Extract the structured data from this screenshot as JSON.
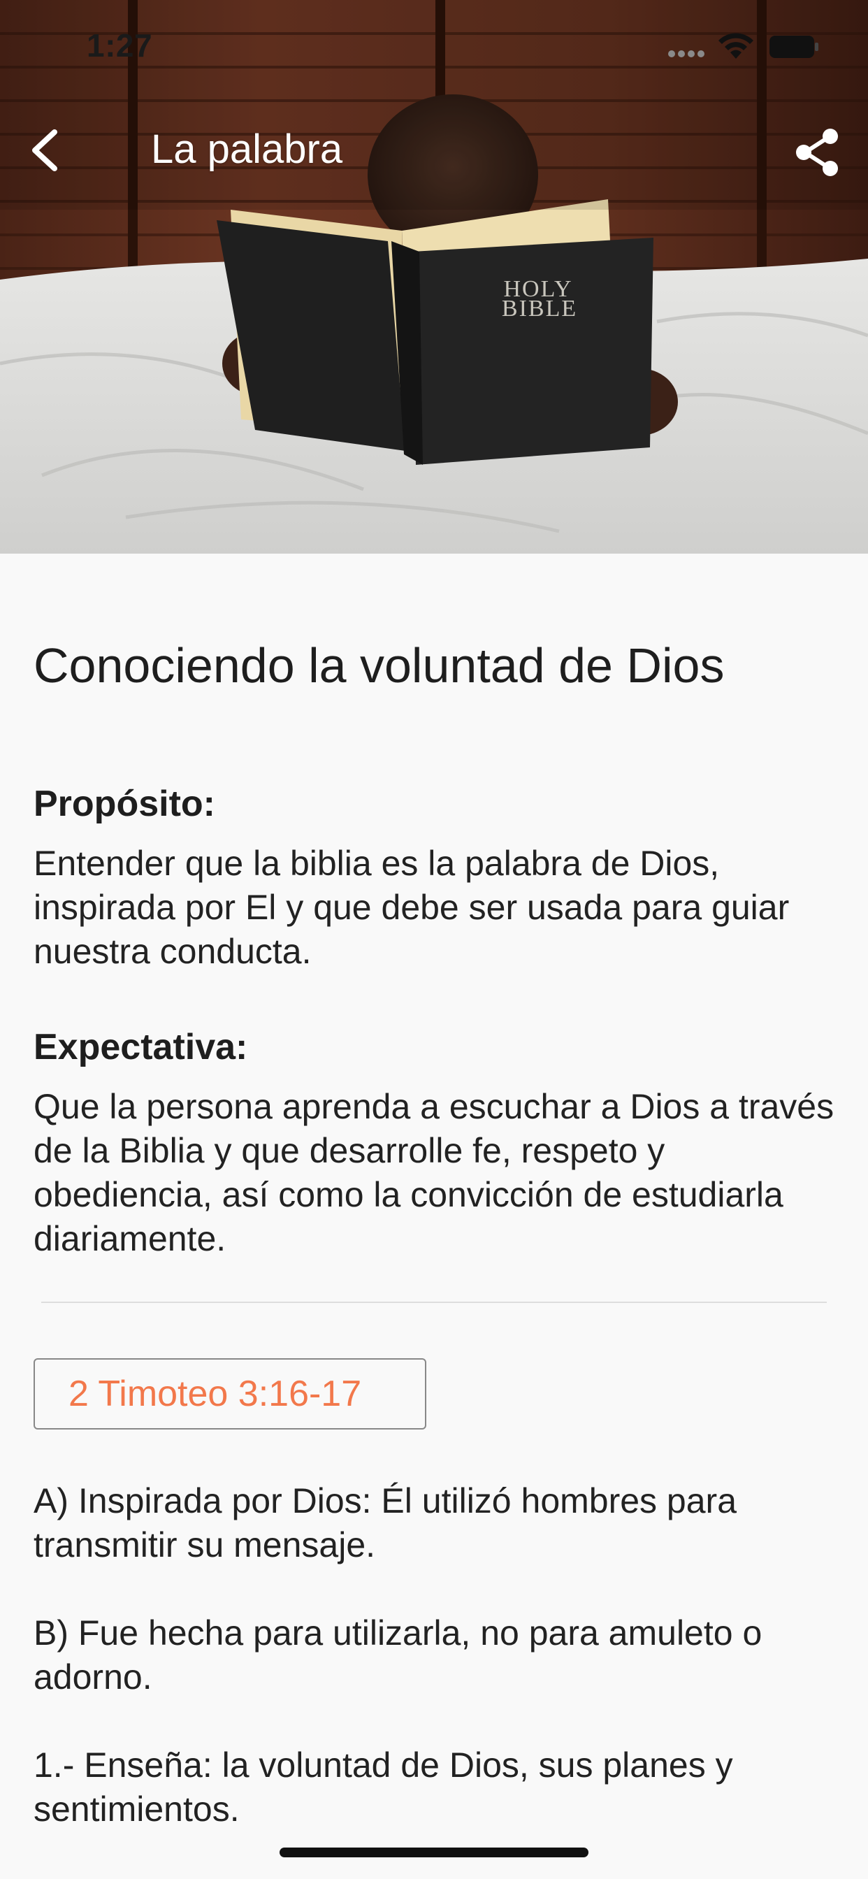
{
  "status_bar": {
    "time": "1:27"
  },
  "nav": {
    "title": "La palabra",
    "back_icon": "chevron-left-icon",
    "share_icon": "share-icon"
  },
  "hero": {
    "book_cover_text_line1": "HOLY",
    "book_cover_text_line2": "BIBLE"
  },
  "article": {
    "title": "Conociendo la voluntad de Dios",
    "purpose_heading": "Propósito:",
    "purpose_body": "Entender que la biblia es la palabra de Dios, inspirada por El y que debe ser usada para guiar nuestra conducta.",
    "expectation_heading": "Expectativa:",
    "expectation_body": "Que la persona aprenda a escuchar a Dios a través de la Biblia y que desarrolle fe, respeto y obediencia, así como la convicción de estudiarla diariamente.",
    "verse_reference": "2 Timoteo 3:16-17",
    "points": [
      "A)  Inspirada por Dios: Él utilizó hombres para transmitir su mensaje.",
      "B)  Fue hecha para utilizarla, no para amuleto o adorno.",
      "1.-  Enseña: la voluntad de Dios, sus planes y sentimientos."
    ]
  },
  "colors": {
    "accent": "#f2784b",
    "background": "#f9f9f9",
    "text": "#222222"
  }
}
